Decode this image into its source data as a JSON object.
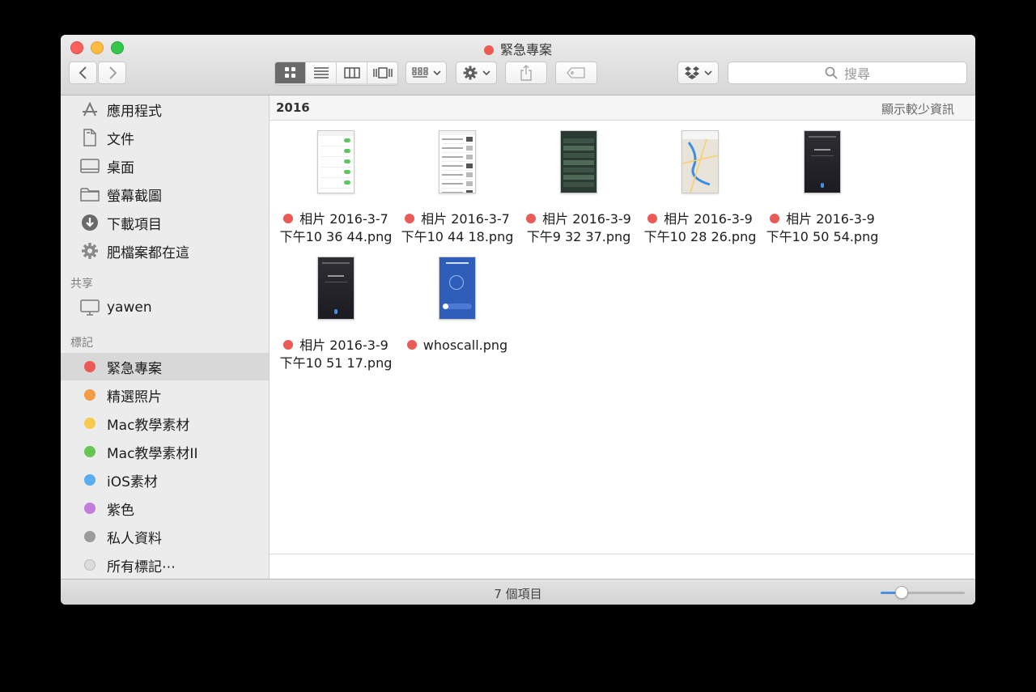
{
  "window": {
    "title": "緊急專案",
    "title_tag_color": "#ec5a55"
  },
  "toolbar": {
    "back_icon": "chevron-left-icon",
    "forward_icon": "chevron-right-icon",
    "views": [
      "icon-view",
      "list-view",
      "column-view",
      "cover-flow-view"
    ],
    "active_view": "icon-view",
    "search_placeholder": "搜尋"
  },
  "sidebar": {
    "favorites": [
      {
        "label": "應用程式",
        "icon": "applications-icon"
      },
      {
        "label": "文件",
        "icon": "documents-icon"
      },
      {
        "label": "桌面",
        "icon": "desktop-icon"
      },
      {
        "label": "螢幕截圖",
        "icon": "folder-icon"
      },
      {
        "label": "下載項目",
        "icon": "downloads-icon"
      },
      {
        "label": "肥檔案都在這",
        "icon": "gear-folder-icon"
      }
    ],
    "shared_heading": "共享",
    "shared": [
      {
        "label": "yawen",
        "icon": "computer-icon"
      }
    ],
    "tags_heading": "標記",
    "tags": [
      {
        "label": "緊急專案",
        "color": "#ec5a55",
        "selected": true
      },
      {
        "label": "精選照片",
        "color": "#f39b45"
      },
      {
        "label": "Mac教學素材",
        "color": "#f6ca4e"
      },
      {
        "label": "Mac教學素材II",
        "color": "#69c552"
      },
      {
        "label": "iOS素材",
        "color": "#5aaef0"
      },
      {
        "label": "紫色",
        "color": "#c17cdc"
      },
      {
        "label": "私人資料",
        "color": "#9b9b9b"
      },
      {
        "label": "所有標記⋯",
        "color": "#dcdcdc"
      }
    ]
  },
  "pathbar": {
    "folder": "2016",
    "toggle": "顯示較少資訊"
  },
  "files": [
    {
      "line1": "相片 2016-3-7",
      "line2": "下午10 36 44.png",
      "tag": "#ec5a55",
      "thumb": "light"
    },
    {
      "line1": "相片 2016-3-7",
      "line2": "下午10 44 18.png",
      "tag": "#ec5a55",
      "thumb": "news"
    },
    {
      "line1": "相片 2016-3-9",
      "line2": "下午9 32 37.png",
      "tag": "#ec5a55",
      "thumb": "dark"
    },
    {
      "line1": "相片 2016-3-9",
      "line2": "下午10 28 26.png",
      "tag": "#ec5a55",
      "thumb": "map"
    },
    {
      "line1": "相片 2016-3-9",
      "line2": "下午10 50 54.png",
      "tag": "#ec5a55",
      "thumb": "siri"
    },
    {
      "line1": "相片 2016-3-9",
      "line2": "下午10 51 17.png",
      "tag": "#ec5a55",
      "thumb": "siri"
    },
    {
      "line1": "whoscall.png",
      "line2": "",
      "tag": "#ec5a55",
      "thumb": "blue"
    }
  ],
  "status": {
    "count": "7 個項目",
    "zoom": 0.25
  }
}
